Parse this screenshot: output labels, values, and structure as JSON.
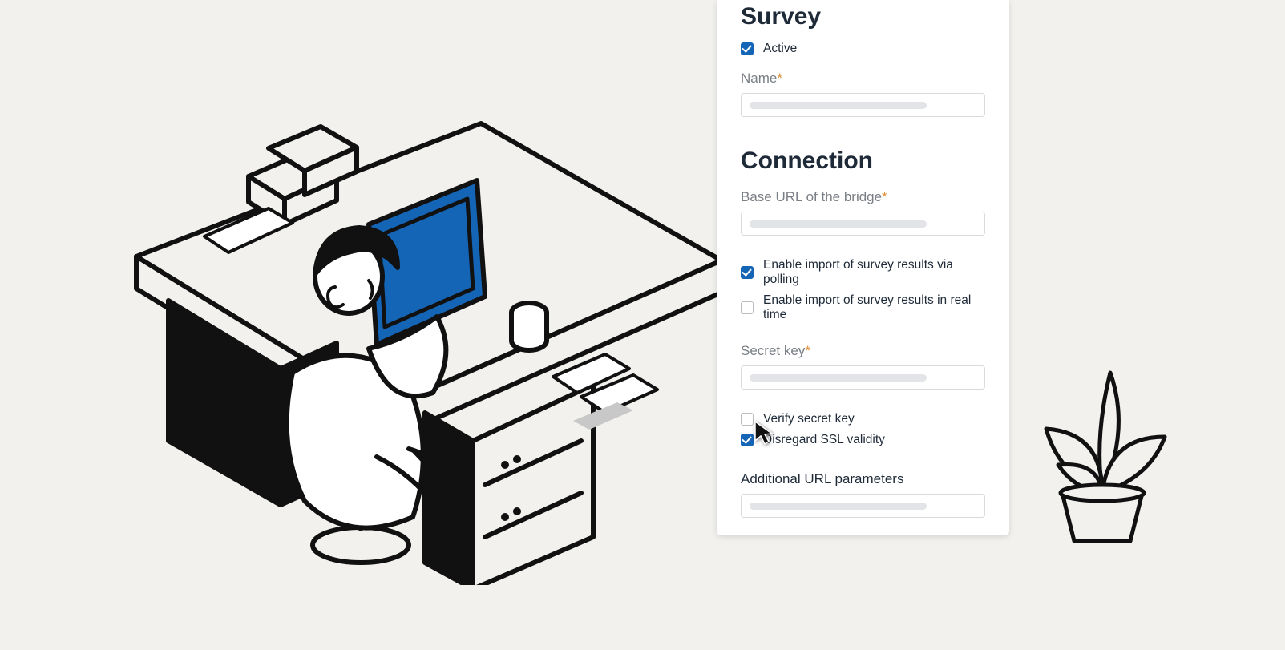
{
  "section_survey": {
    "title": "Survey",
    "active_label": "Active",
    "active_checked": true,
    "name_label": "Name"
  },
  "section_connection": {
    "title": "Connection",
    "base_url_label": "Base URL of the bridge",
    "polling_label": "Enable import of survey results via polling",
    "polling_checked": true,
    "realtime_label": "Enable import of survey results in real time",
    "realtime_checked": false,
    "secret_key_label": "Secret key",
    "verify_label": "Verify secret key",
    "verify_checked": false,
    "ssl_label": "Disregard SSL validity",
    "ssl_checked": true,
    "url_params_label": "Additional URL parameters"
  }
}
